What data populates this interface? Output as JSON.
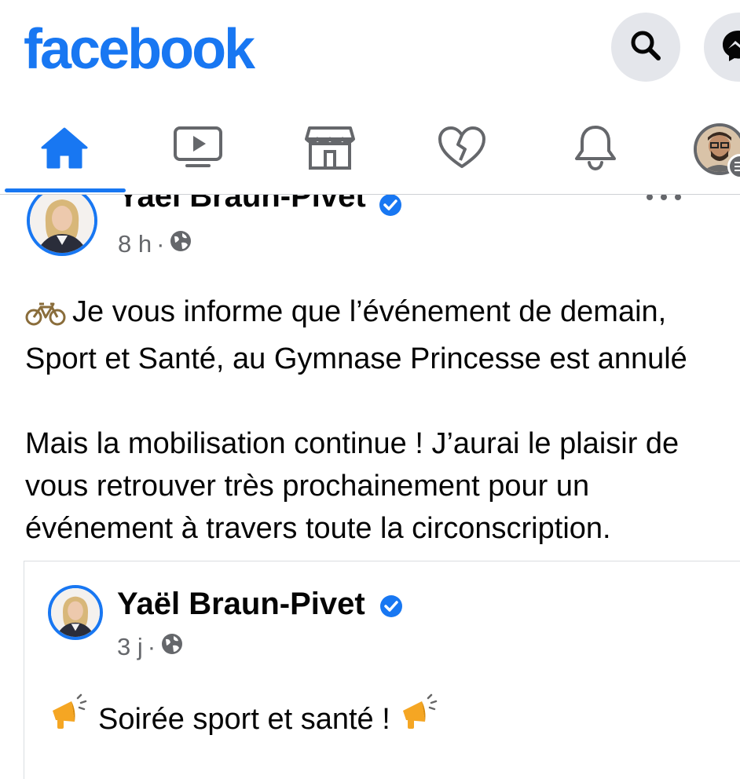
{
  "header": {
    "logo": "facebook",
    "search_icon": "search-icon",
    "messenger_icon": "messenger-icon"
  },
  "tabs": [
    {
      "name": "home",
      "icon": "home-icon",
      "active": true
    },
    {
      "name": "watch",
      "icon": "video-icon",
      "active": false
    },
    {
      "name": "marketplace",
      "icon": "store-icon",
      "active": false
    },
    {
      "name": "dating",
      "icon": "heart-icon",
      "active": false
    },
    {
      "name": "notifications",
      "icon": "bell-icon",
      "active": false
    },
    {
      "name": "menu",
      "icon": "profile-avatar",
      "active": false
    }
  ],
  "post": {
    "author": "Yaël Braun-Pivet",
    "time": "8 h",
    "separator": "·",
    "lines_para1": [
      "Je vous informe que l’événement de demain,",
      "Sport et Santé, au Gymnase Princesse est annulé"
    ],
    "lines_para2": [
      "Mais la mobilisation continue ! J’aurai le plaisir de",
      "vous retrouver très prochainement pour un",
      "événement à travers toute la circonscription."
    ]
  },
  "shared_post": {
    "author": "Yaël Braun-Pivet",
    "time": "3 j",
    "separator": "·",
    "text": "Soirée sport et santé !"
  },
  "colors": {
    "brand": "#1877f2",
    "text": "#050505",
    "secondary": "#65676b",
    "button_bg": "#e4e6eb"
  }
}
